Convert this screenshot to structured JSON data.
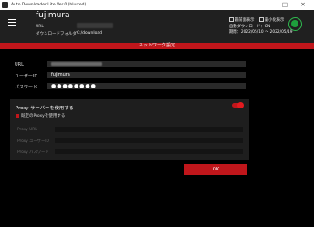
{
  "window": {
    "title": "Auto Downloader Lite Ver.0.(blurred)",
    "minimize": "—",
    "maximize": "□",
    "close": "✕"
  },
  "header": {
    "profile_name": "fujimura",
    "url_label": "URL",
    "url_value": "https://(blurred)",
    "download_folder_label": "ダウンロードフォルダ",
    "download_folder_value": "C:/download",
    "options": [
      {
        "label": "最前面表示",
        "checked": false
      },
      {
        "label": "最小化表示",
        "checked": false
      }
    ],
    "auto_download": "自動ダウンロード：ON",
    "period": "期間：2022/05/10 〜 2022/05/19"
  },
  "section_title": "ネットワーク設定",
  "form": {
    "url_label": "URL",
    "url_value": "https://(blurred)",
    "user_label": "ユーザーID",
    "user_value": "fujimura",
    "password_label": "パスワード",
    "password_value": "●●●●●●●●"
  },
  "proxy": {
    "title": "Proxy サーバーを使用する",
    "enabled": true,
    "use_existing_label": "既定のProxyを使用する",
    "use_existing_checked": true,
    "url_label": "Proxy URL",
    "user_label": "Proxy ユーザーID",
    "password_label": "Proxy パスワード"
  },
  "ok_button": "OK",
  "colors": {
    "accent": "#c0161b",
    "status_ok": "#1e9e3c"
  }
}
